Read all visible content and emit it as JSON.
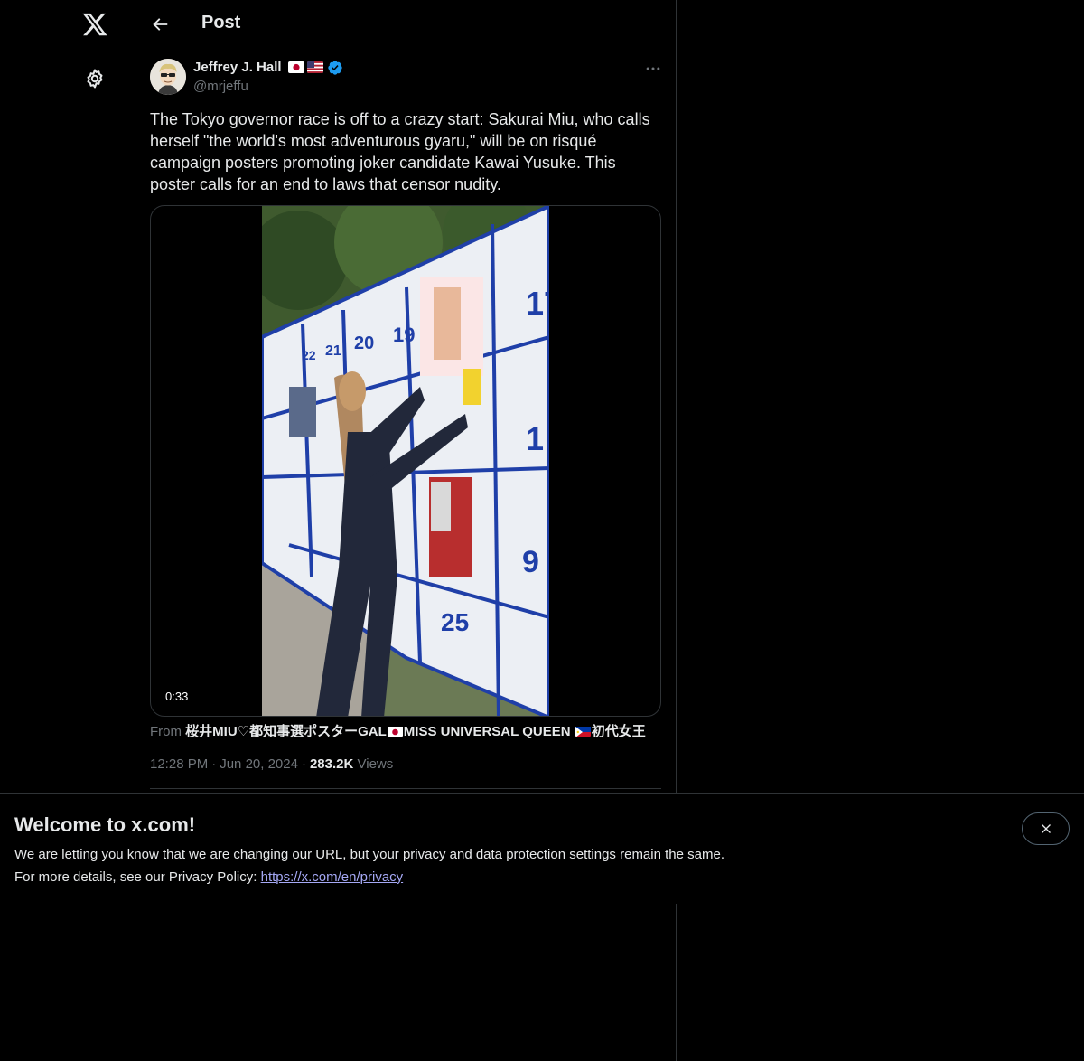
{
  "header": {
    "title": "Post"
  },
  "post": {
    "author_name": "Jeffrey J. Hall",
    "author_handle": "@mrjeffu",
    "text": "The Tokyo governor race is off to a crazy start: Sakurai Miu, who calls herself \"the world's most adventurous gyaru,\" will be on risqué campaign posters promoting joker candidate Kawai Yusuke. This poster calls for an end to laws that censor nudity.",
    "video_duration": "0:33",
    "source_prefix": "From",
    "source_name_part1": "桜井MIU♡都知事選ポスターGAL",
    "source_name_part2": "MISS UNIVERSAL QUEEN",
    "source_name_part3": "初代女王",
    "time": "12:28 PM",
    "date": "Jun 20, 2024",
    "views_count": "283.2K",
    "views_label": "Views"
  },
  "banner": {
    "title": "Welcome to x.com!",
    "line1": "We are letting you know that we are changing our URL, but your privacy and data protection settings remain the same.",
    "line2_prefix": "For more details, see our Privacy Policy:",
    "link": "https://x.com/en/privacy"
  },
  "colors": {
    "background": "#000000",
    "text_primary": "#e7e9ea",
    "text_secondary": "#71767b",
    "verified_blue": "#1d9bf0",
    "link": "#a5a8f5",
    "border": "#2f3336"
  },
  "icons": {
    "logo": "x-logo-icon",
    "settings": "gear-icon",
    "back": "arrow-left-icon",
    "verified": "verified-badge-icon",
    "more": "more-horizontal-icon",
    "close": "close-icon"
  }
}
